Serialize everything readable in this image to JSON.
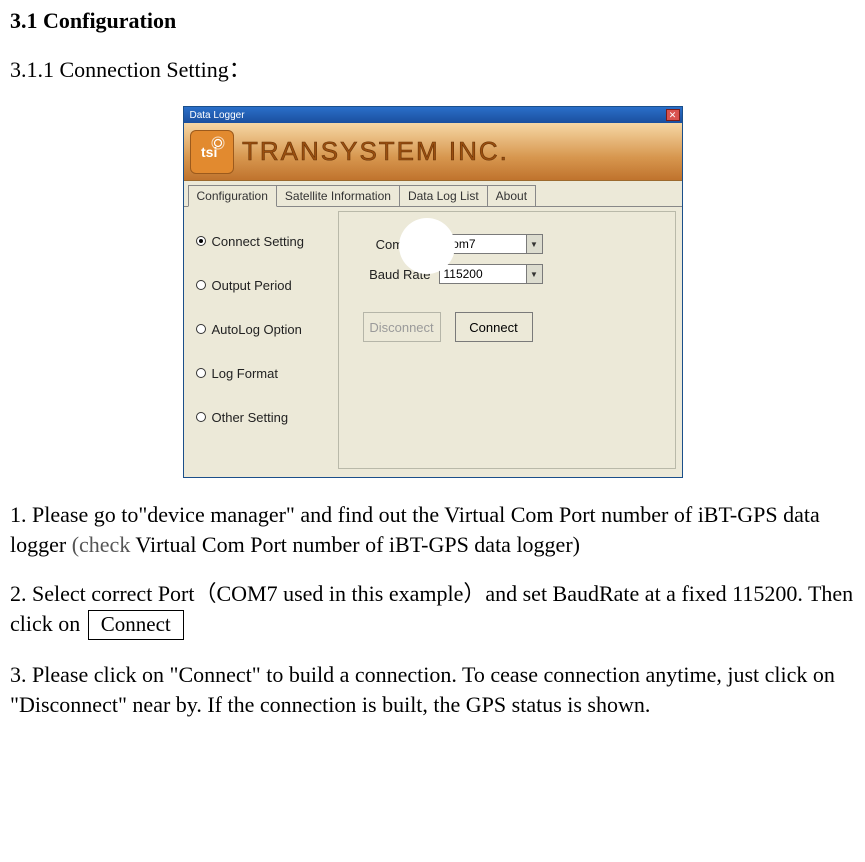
{
  "headings": {
    "h1": "3.1 Configuration",
    "h2": "3.1.1 Connection Setting："
  },
  "window": {
    "title": "Data Logger",
    "close_glyph": "✕",
    "company": "TRANSYSTEM INC.",
    "logo_letters": "tsi",
    "tabs": [
      "Configuration",
      "Satellite Information",
      "Data Log List",
      "About"
    ],
    "radios": [
      "Connect Setting",
      "Output Period",
      "AutoLog Option",
      "Log Format",
      "Other Setting"
    ],
    "form": {
      "com_port_label": "Com Port",
      "com_port_value": "Com7",
      "baud_rate_label": "Baud Rate",
      "baud_rate_value": "115200",
      "disconnect_label": "Disconnect",
      "connect_label": "Connect"
    }
  },
  "text": {
    "p1a": "1. Please go to\"device manager\" and find out the Virtual Com Port number of iBT-GPS data logger ",
    "p1b": "(check",
    "p1c": " Virtual Com Port number of iBT-GPS data logger)",
    "p2a": "2. Select correct Port（COM7 used in this example）and set BaudRate at a fixed 115200. Then click on ",
    "p2_btn": "Connect",
    "p3": "3. Please click on \"Connect\" to build a connection. To cease connection anytime, just click on \"Disconnect\" near by. If the connection is built, the GPS status is shown."
  }
}
